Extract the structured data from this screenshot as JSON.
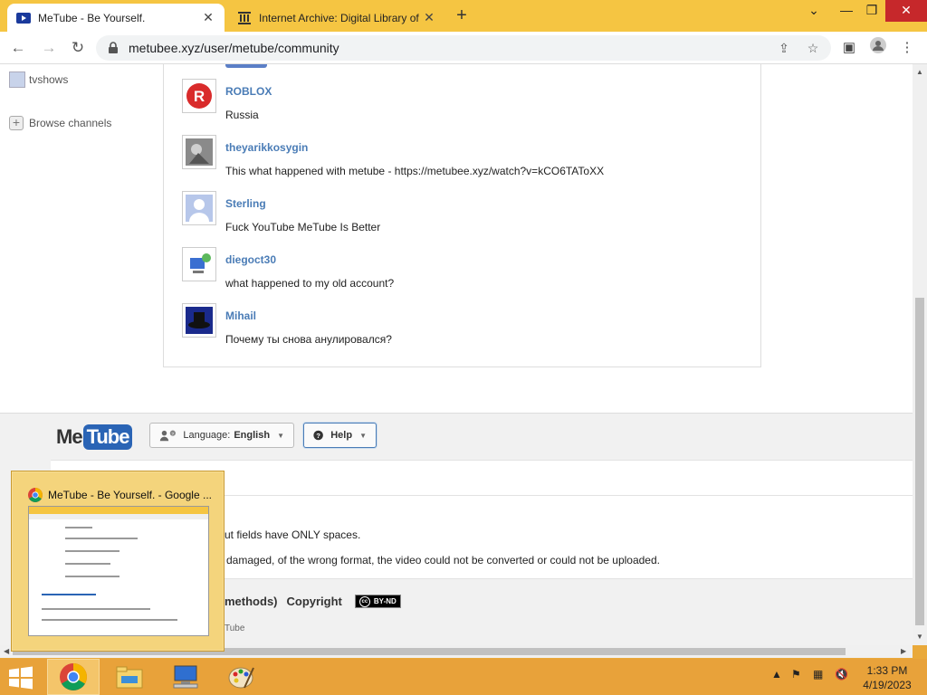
{
  "browser": {
    "tabs": [
      {
        "title": "MeTube - Be Yourself.",
        "active": true
      },
      {
        "title": "Internet Archive: Digital Library of Free & Borrowable Books, Movies, Music & Wayback Machine",
        "active": false
      }
    ],
    "url": "metubee.xyz/user/metube/community"
  },
  "sidebar": {
    "items": [
      {
        "label": "tvshows"
      },
      {
        "label": "Browse channels"
      }
    ]
  },
  "comments": [
    {
      "author": "ROBLOX",
      "text": "Russia",
      "avatar": "roblox-logo"
    },
    {
      "author": "theyarikkosygin",
      "text": "This what happened with metube - https://metubee.xyz/watch?v=kCO6TAToXX",
      "avatar": "photo"
    },
    {
      "author": "Sterling",
      "text": "Fuck YouTube MeTube Is Better",
      "avatar": "default-user"
    },
    {
      "author": "diegoct30",
      "text": "what happened to my old account?",
      "avatar": "computer"
    },
    {
      "author": "Mihail",
      "text": "Почему ты снова анулировался?",
      "avatar": "dark-hat"
    }
  ],
  "footer": {
    "logo_me": "Me",
    "logo_tube": "Tube",
    "language_label": "Language:",
    "language_value": "English",
    "help_label": "Help",
    "text1": "ut fields have ONLY spaces.",
    "text2": "damaged, of the wrong format, the video could not be converted or could not be uploaded.",
    "methods": "methods)",
    "copyright": "Copyright",
    "cc_label": "BY-ND",
    "bottom": "Tube"
  },
  "preview": {
    "title": "MeTube - Be Yourself. - Google ..."
  },
  "taskbar": {
    "time": "1:33 PM",
    "date": "4/19/2023"
  },
  "colors": {
    "accent": "#4a7cb6",
    "taskbar": "#e8a23a",
    "tabbar": "#f5c542"
  }
}
